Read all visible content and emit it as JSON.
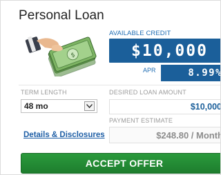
{
  "card": {
    "title": "Personal Loan",
    "available_credit_label": "AVAILABLE CREDIT",
    "available_credit_value": "$10,000",
    "apr_label": "APR",
    "apr_value": "8.99%"
  },
  "form": {
    "term_length_label": "TERM LENGTH",
    "term_selected": "48 mo",
    "desired_amount_label": "DESIRED LOAN AMOUNT",
    "desired_amount_value": "$10,000",
    "payment_estimate_label": "PAYMENT ESTIMATE",
    "payment_estimate_value": "$248.80 / Month",
    "details_link": "Details & Disclosures"
  },
  "actions": {
    "accept_label": "ACCEPT OFFER"
  },
  "icons": {
    "illustration": "hand-holding-cash-icon",
    "select_arrow": "chevron-down-icon"
  },
  "colors": {
    "brand_blue": "#1b5f9a",
    "accept_green": "#1e7e2e",
    "link_blue": "#1f5fa6"
  }
}
